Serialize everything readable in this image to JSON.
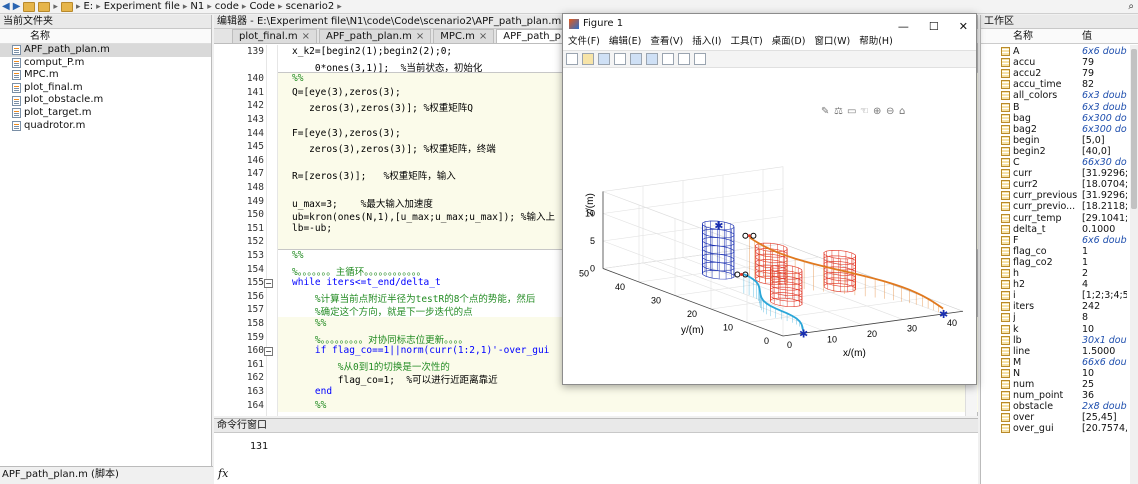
{
  "address": {
    "crumbs": [
      "E:",
      "Experiment file",
      "N1",
      "code",
      "Code",
      "scenario2"
    ]
  },
  "file_browser": {
    "title": "当前文件夹",
    "column": "名称",
    "files": [
      {
        "name": "APF_path_plan.m",
        "selected": true
      },
      {
        "name": "comput_P.m"
      },
      {
        "name": "MPC.m"
      },
      {
        "name": "plot_final.m"
      },
      {
        "name": "plot_obstacle.m"
      },
      {
        "name": "plot_target.m"
      },
      {
        "name": "quadrotor.m"
      }
    ],
    "status": "APF_path_plan.m (脚本)"
  },
  "editor": {
    "title": "编辑器 - E:\\Experiment file\\N1\\code\\Code\\scenario2\\APF_path_plan.m",
    "tabs": [
      {
        "label": "plot_final.m"
      },
      {
        "label": "APF_path_plan.m"
      },
      {
        "label": "MPC.m"
      },
      {
        "label": "APF_path_plan.m",
        "active": true
      }
    ],
    "lines": [
      {
        "n": "139",
        "t": "x_k2=[begin2(1);begin2(2);0;"
      },
      {
        "n": "",
        "t": "    0*ones(3,1)];  %当前状态，初始化"
      },
      {
        "n": "140",
        "t": "%%"
      },
      {
        "n": "141",
        "t": "Q=[eye(3),zeros(3);"
      },
      {
        "n": "142",
        "t": "   zeros(3),zeros(3)]; %权重矩阵Q"
      },
      {
        "n": "143",
        "t": ""
      },
      {
        "n": "144",
        "t": "F=[eye(3),zeros(3);"
      },
      {
        "n": "145",
        "t": "   zeros(3),zeros(3)]; %权重矩阵，终端"
      },
      {
        "n": "146",
        "t": ""
      },
      {
        "n": "147",
        "t": "R=[zeros(3)];   %权重矩阵，输入"
      },
      {
        "n": "148",
        "t": ""
      },
      {
        "n": "149",
        "t": "u_max=3;    %最大输入加速度"
      },
      {
        "n": "150",
        "t": "ub=kron(ones(N,1),[u_max;u_max;u_max]); %输入上"
      },
      {
        "n": "151",
        "t": "lb=-ub;"
      },
      {
        "n": "152",
        "t": ""
      },
      {
        "n": "153",
        "t": "%%"
      },
      {
        "n": "154",
        "t": "%。。。。。。。主循环。。。。。。。。。。。。"
      },
      {
        "n": "155",
        "t": "while iters<=t_end/delta_t"
      },
      {
        "n": "156",
        "t": "    %计算当前点附近半径为testR的8个点的势能，然后"
      },
      {
        "n": "157",
        "t": "    %确定这个方向，就是下一步迭代的点"
      },
      {
        "n": "158",
        "t": "    %%"
      },
      {
        "n": "159",
        "t": "    %。。。。。。。。。对协同标志位更新。。。。"
      },
      {
        "n": "160",
        "t": "    if flag_co==1||norm(curr(1:2,1)'-over_gui"
      },
      {
        "n": "161",
        "t": "        %从0到1的切换是一次性的"
      },
      {
        "n": "162",
        "t": "        flag_co=1;  %可以进行近距离靠近"
      },
      {
        "n": "163",
        "t": "    end"
      },
      {
        "n": "164",
        "t": "    %%"
      }
    ]
  },
  "command_window": {
    "title": "命令行窗口",
    "output": "131",
    "prompt_icon": "fx"
  },
  "workspace": {
    "title": "工作区",
    "col_name": "名称",
    "col_value": "值",
    "vars": [
      {
        "name": "A",
        "value": "6x6 double",
        "it": true
      },
      {
        "name": "accu",
        "value": "79"
      },
      {
        "name": "accu2",
        "value": "79"
      },
      {
        "name": "accu_time",
        "value": "82"
      },
      {
        "name": "all_colors",
        "value": "6x3 double",
        "it": true
      },
      {
        "name": "B",
        "value": "6x3 double",
        "it": true
      },
      {
        "name": "bag",
        "value": "6x300 double",
        "it": true
      },
      {
        "name": "bag2",
        "value": "6x300 double",
        "it": true
      },
      {
        "name": "begin",
        "value": "[5,0]"
      },
      {
        "name": "begin2",
        "value": "[40,0]"
      },
      {
        "name": "C",
        "value": "66x30 double",
        "it": true
      },
      {
        "name": "curr",
        "value": "[31.9296;5"
      },
      {
        "name": "curr2",
        "value": "[18.0704;5"
      },
      {
        "name": "curr_previous",
        "value": "[31.9296;5"
      },
      {
        "name": "curr_previo...",
        "value": "[18.2118;5"
      },
      {
        "name": "curr_temp",
        "value": "[29.1041;4"
      },
      {
        "name": "delta_t",
        "value": "0.1000"
      },
      {
        "name": "F",
        "value": "6x6 double",
        "it": true
      },
      {
        "name": "flag_co",
        "value": "1"
      },
      {
        "name": "flag_co2",
        "value": "1"
      },
      {
        "name": "h",
        "value": "2"
      },
      {
        "name": "h2",
        "value": "4"
      },
      {
        "name": "i",
        "value": "[1;2;3;4;5;6"
      },
      {
        "name": "iters",
        "value": "242"
      },
      {
        "name": "j",
        "value": "8"
      },
      {
        "name": "k",
        "value": "10"
      },
      {
        "name": "lb",
        "value": "30x1 double",
        "it": true
      },
      {
        "name": "line",
        "value": "1.5000"
      },
      {
        "name": "M",
        "value": "66x6 double",
        "it": true
      },
      {
        "name": "N",
        "value": "10"
      },
      {
        "name": "num",
        "value": "25"
      },
      {
        "name": "num_point",
        "value": "36"
      },
      {
        "name": "obstacle",
        "value": "2x8 double",
        "it": true
      },
      {
        "name": "over",
        "value": "[25,45]"
      },
      {
        "name": "over_gui",
        "value": "[20.7574,4"
      }
    ]
  },
  "figure": {
    "title": "Figure 1",
    "menu": [
      "文件(F)",
      "编辑(E)",
      "查看(V)",
      "插入(I)",
      "工具(T)",
      "桌面(D)",
      "窗口(W)",
      "帮助(H)"
    ],
    "axes": {
      "xlabel": "x/(m)",
      "ylabel": "y/(m)",
      "zlabel": "z/(m)",
      "xticks": [
        "0",
        "10",
        "20",
        "30",
        "40"
      ],
      "yticks": [
        "0",
        "10",
        "20",
        "30",
        "40",
        "50"
      ],
      "zticks": [
        "0",
        "5",
        "10"
      ]
    },
    "colors": {
      "path1": "#e0791f",
      "path2": "#2aa6d8",
      "obstacle": "#e23a2a",
      "target": "#1a2fb0"
    }
  }
}
